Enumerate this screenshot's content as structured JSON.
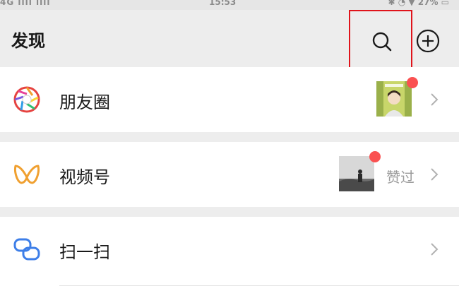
{
  "status_bar": {
    "left": "4G ııll  ııll",
    "time": "15:53",
    "right": "✱ ◔ ▼ 27% ▭"
  },
  "header": {
    "title": "发现",
    "search_icon": "search-icon",
    "add_icon": "add-circle-icon"
  },
  "items": [
    {
      "label": "朋友圈",
      "icon": "moments-aperture-icon",
      "has_thumbnail": true,
      "has_red_dot": true,
      "extra": ""
    },
    {
      "label": "视频号",
      "icon": "channels-icon",
      "has_thumbnail": true,
      "has_red_dot": true,
      "extra": "赞过"
    },
    {
      "label": "扫一扫",
      "icon": "scan-icon",
      "has_thumbnail": false,
      "has_red_dot": false,
      "extra": ""
    }
  ],
  "colors": {
    "background": "#ededed",
    "row_background": "#ffffff",
    "red_dot": "#fa5151",
    "highlight_box": "#e0141b",
    "scan_blue": "#3d7ee8",
    "channels_orange": "#f0a030"
  }
}
